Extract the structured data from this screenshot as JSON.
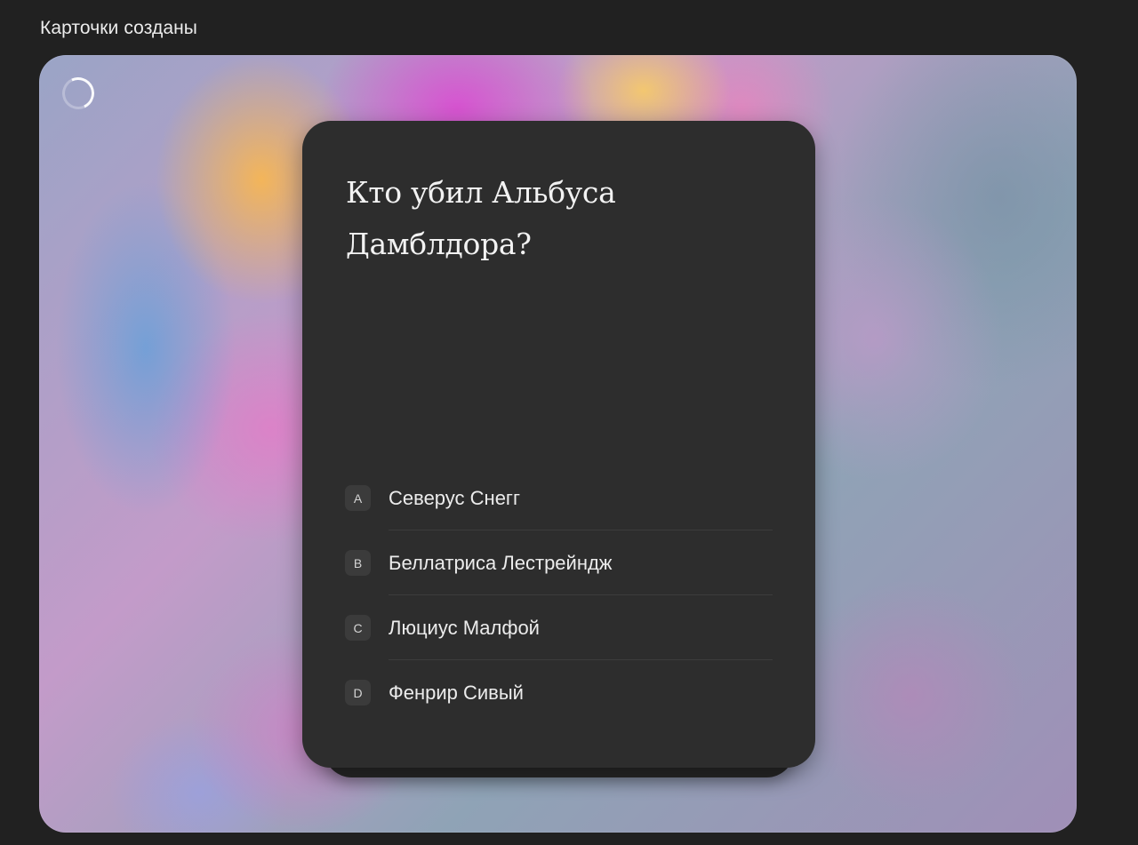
{
  "header": {
    "title": "Карточки созданы"
  },
  "card": {
    "question": "Кто убил Альбуса Дамблдора?",
    "options": [
      {
        "letter": "A",
        "text": "Северус Снегг"
      },
      {
        "letter": "B",
        "text": "Беллатриса Лестрейндж"
      },
      {
        "letter": "C",
        "text": "Люциус Малфой"
      },
      {
        "letter": "D",
        "text": "Фенрир Сивый"
      }
    ]
  },
  "colors": {
    "page_background": "#212121",
    "card_background": "#2d2d2d",
    "text_primary": "#f2f2f2"
  }
}
